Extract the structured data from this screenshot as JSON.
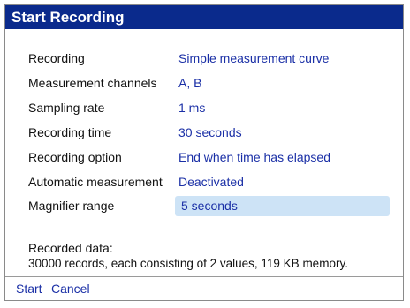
{
  "dialog": {
    "title": "Start Recording"
  },
  "settings": [
    {
      "label": "Recording",
      "value": "Simple measurement curve"
    },
    {
      "label": "Measurement channels",
      "value": "A, B"
    },
    {
      "label": "Sampling rate",
      "value": "1 ms"
    },
    {
      "label": "Recording time",
      "value": "30 seconds"
    },
    {
      "label": "Recording option",
      "value": "End when time has elapsed"
    },
    {
      "label": "Automatic measurement",
      "value": "Deactivated"
    },
    {
      "label": "Magnifier range",
      "value": "5 seconds"
    }
  ],
  "info": {
    "heading": "Recorded data:",
    "text": "30000 records, each consisting of 2 values, 119 KB memory."
  },
  "actions": {
    "start": "Start",
    "cancel": "Cancel"
  },
  "colors": {
    "title_bar": "#0a2a8c",
    "value_text": "#1a2fa6",
    "selection": "#cde3f6"
  }
}
